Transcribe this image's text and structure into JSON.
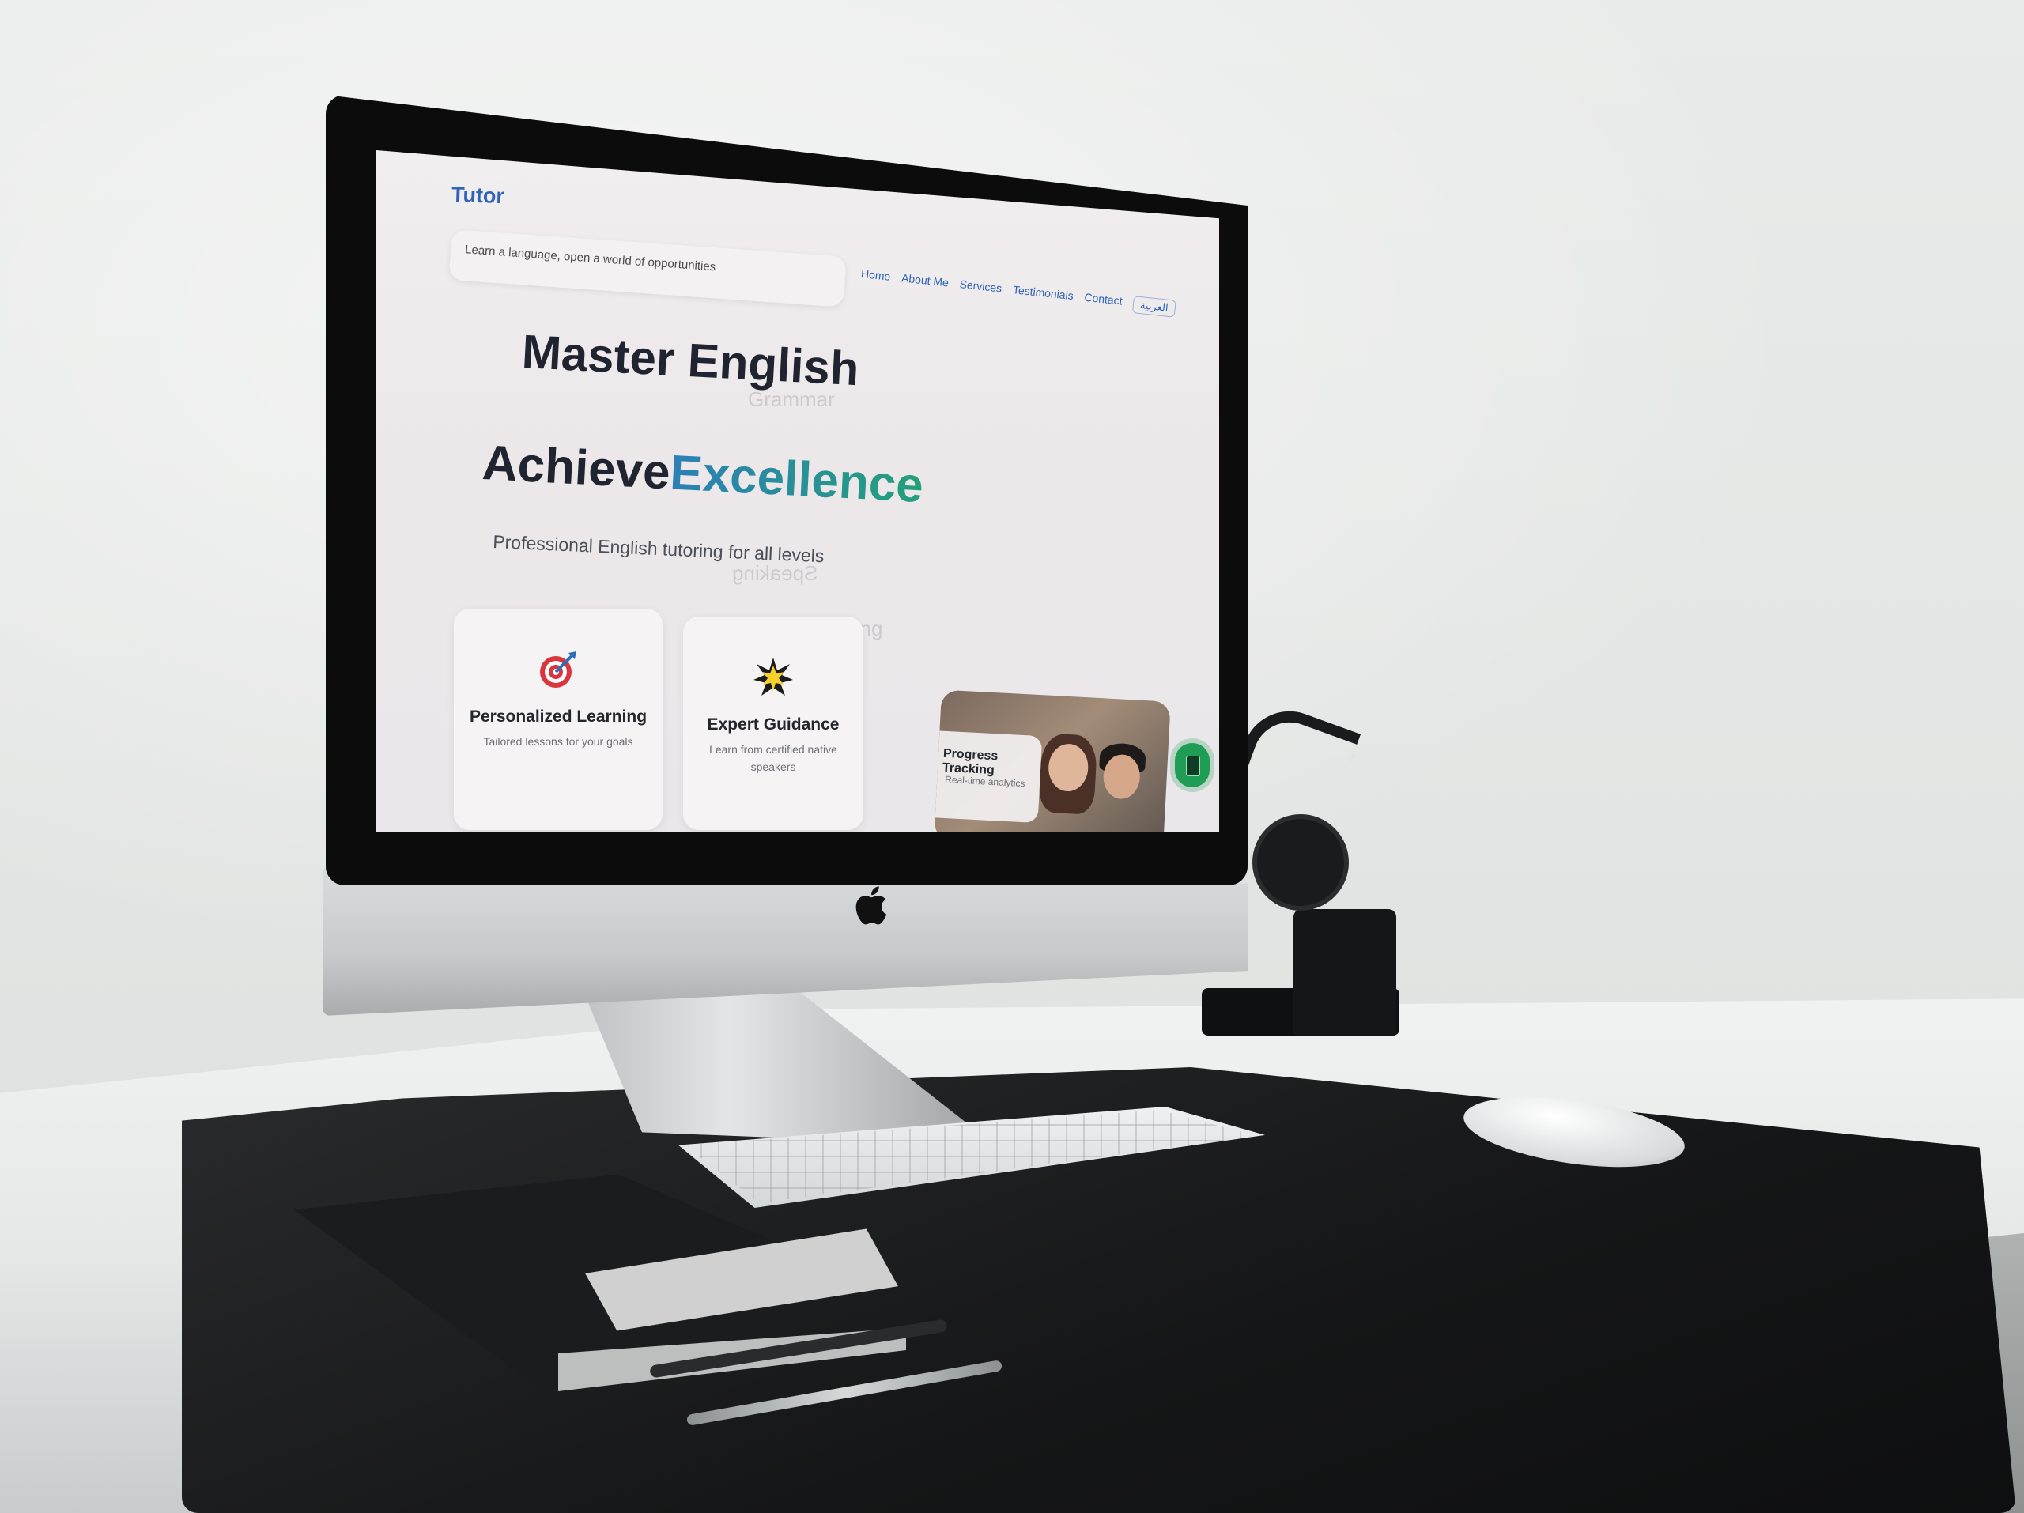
{
  "site": {
    "logo": "Tutor",
    "tagline": "Learn a language, open a world of opportunities",
    "nav": [
      "Home",
      "About Me",
      "Services",
      "Testimonials",
      "Contact"
    ],
    "language_button": "العربية"
  },
  "hero": {
    "headline_line1": "Master English",
    "headline_line2_part1": "Achieve",
    "headline_line2_part2": "Excellence",
    "subheadline": "Professional English tutoring for all levels"
  },
  "features": [
    {
      "title": "Personalized Learning",
      "description": "Tailored lessons for your goals",
      "icon": "target-icon"
    },
    {
      "title": "Expert Guidance",
      "description": "Learn from certified native speakers",
      "icon": "star-burst-icon"
    }
  ],
  "video_card": {
    "title": "Progress Tracking",
    "description": "Real-time analytics"
  },
  "background_words": [
    "Speaking",
    "Writing",
    "Grammar"
  ],
  "colors": {
    "brand_blue": "#2f64b8",
    "gradient_start": "#2d7fb6",
    "gradient_end": "#23a07a",
    "fab_green": "#1f9d55"
  }
}
